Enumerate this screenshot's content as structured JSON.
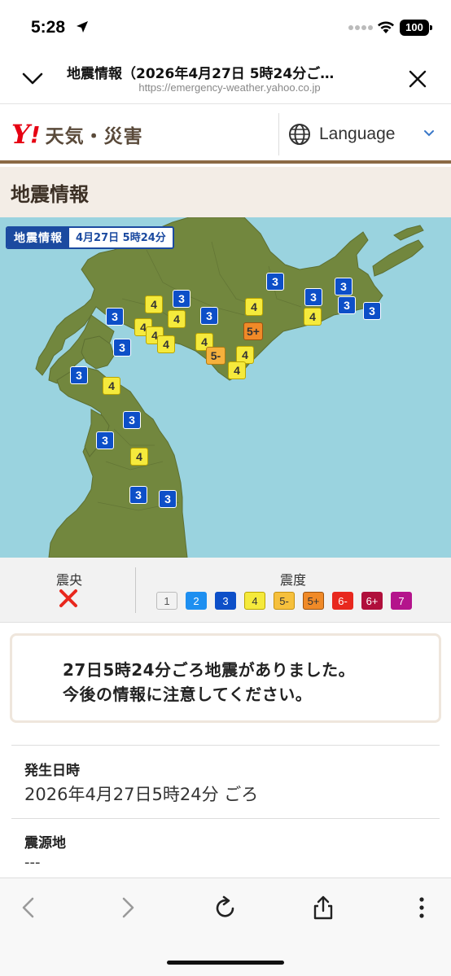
{
  "status": {
    "time": "5:28",
    "battery": "100"
  },
  "browser": {
    "title": "地震情報（2026年4月27日 5時24分ご…",
    "url": "https://emergency-weather.yahoo.co.jp"
  },
  "site": {
    "logo_y": "Y",
    "logo_excl": "!",
    "logo_text": "天気・災害",
    "language_label": "Language"
  },
  "page": {
    "title": "地震情報"
  },
  "map": {
    "badge_label": "地震情報",
    "badge_time": "4月27日 5時24分"
  },
  "legend": {
    "epicenter_title": "震央",
    "intensity_title": "震度",
    "scale": [
      {
        "label": "1",
        "bg": "#f2f2f2",
        "fg": "#555",
        "border": "#bbbbbb"
      },
      {
        "label": "2",
        "bg": "#1e8ff0",
        "fg": "#ffffff",
        "border": "#1e8ff0"
      },
      {
        "label": "3",
        "bg": "#0d4fc8",
        "fg": "#ffffff",
        "border": "#0d4fc8"
      },
      {
        "label": "4",
        "bg": "#f5ea3c",
        "fg": "#333333",
        "border": "#bba500"
      },
      {
        "label": "5-",
        "bg": "#f6c03c",
        "fg": "#333333",
        "border": "#c49010"
      },
      {
        "label": "5+",
        "bg": "#f08a28",
        "fg": "#333333",
        "border": "#9c5310"
      },
      {
        "label": "6-",
        "bg": "#e8281e",
        "fg": "#ffffff",
        "border": "#e8281e"
      },
      {
        "label": "6+",
        "bg": "#b0103c",
        "fg": "#ffffff",
        "border": "#b0103c"
      },
      {
        "label": "7",
        "bg": "#b4148c",
        "fg": "#ffffff",
        "border": "#b4148c"
      }
    ]
  },
  "notice": {
    "line1": "27日5時24分ごろ地震がありました。",
    "line2": "今後の情報に注意してください。"
  },
  "info": {
    "occurred_label": "発生日時",
    "occurred_value": "2026年4月27日5時24分 ごろ",
    "hypocenter_label": "震源地",
    "hypocenter_value": "---"
  },
  "colors": {
    "accent_brown": "#8b6a45",
    "yahoo_red": "#e60012",
    "sea": "#9ad3df",
    "land": "#72873e"
  }
}
